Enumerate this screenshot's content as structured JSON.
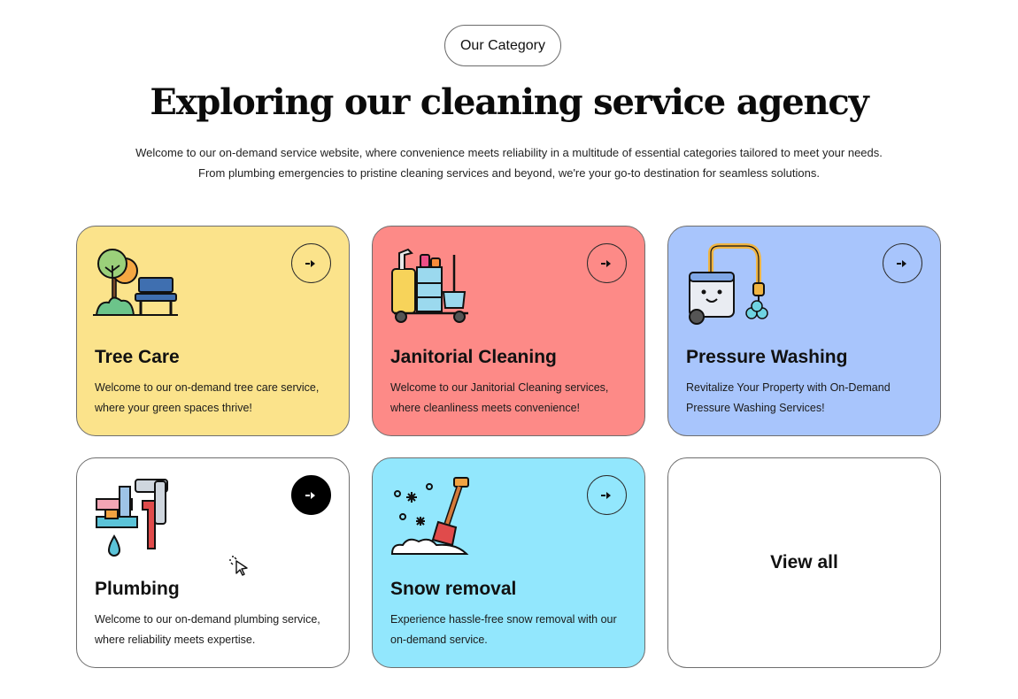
{
  "header": {
    "pill_label": "Our Category",
    "title": "Exploring our cleaning service agency",
    "intro_line1": "Welcome to our on-demand service website, where convenience meets reliability in a multitude of essential categories tailored to meet your needs.",
    "intro_line2": "From plumbing emergencies to pristine cleaning services and beyond, we're your go-to destination for seamless solutions."
  },
  "cards": [
    {
      "title": "Tree Care",
      "desc": "Welcome to our on-demand tree care service, where your green spaces thrive!",
      "bg": "#fbe38b",
      "icon": "park-tree-bench-icon"
    },
    {
      "title": "Janitorial Cleaning",
      "desc": "Welcome to our Janitorial Cleaning services, where cleanliness meets convenience!",
      "bg": "#fd8a87",
      "icon": "janitor-cart-icon"
    },
    {
      "title": "Pressure Washing",
      "desc": "Revitalize Your Property with On-Demand Pressure Washing Services!",
      "bg": "#a8c5fc",
      "icon": "pressure-washer-icon"
    },
    {
      "title": "Plumbing",
      "desc": "Welcome to our on-demand plumbing service, where reliability meets expertise.",
      "bg": "#ffffff",
      "icon": "pipes-wrench-icon"
    },
    {
      "title": "Snow removal",
      "desc": "Experience hassle-free snow removal with our on-demand service.",
      "bg": "#92e7fd",
      "icon": "snow-shovel-icon"
    }
  ],
  "view_all": {
    "label": "View all"
  },
  "icons": {
    "arrow": "arrow-right-icon",
    "cursor": "pointer-cursor-icon"
  }
}
